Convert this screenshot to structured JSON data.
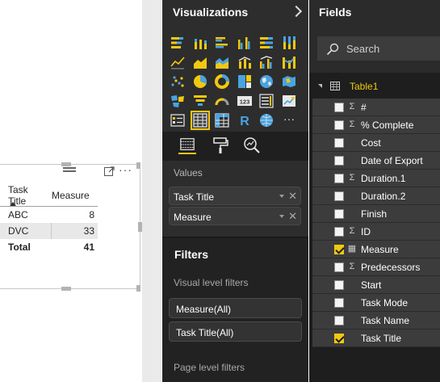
{
  "visual": {
    "table": {
      "columns": [
        "Task Title",
        "Measure"
      ],
      "rows": [
        {
          "task_title": "ABC",
          "measure": "8"
        },
        {
          "task_title": "DVC",
          "measure": "33"
        }
      ],
      "total": {
        "label": "Total",
        "value": "41"
      }
    },
    "more_label": "···"
  },
  "visualizations": {
    "title": "Visualizations",
    "icons": [
      "stacked-bar-chart",
      "stacked-column-chart",
      "clustered-bar-chart",
      "clustered-column-chart",
      "100-stacked-bar-chart",
      "100-stacked-column-chart",
      "line-chart",
      "area-chart",
      "stacked-area-chart",
      "line-and-stacked-column-chart",
      "line-and-clustered-column-chart",
      "ribbon-chart",
      "scatter-chart",
      "pie-chart",
      "donut-chart",
      "treemap",
      "map",
      "filled-map",
      "shape-map",
      "funnel",
      "gauge",
      "card",
      "multi-row-card",
      "kpi",
      "slicer",
      "table",
      "matrix",
      "r-script-visual",
      "globe-map",
      "more"
    ],
    "icon_text": {
      "card": "123",
      "r_visual": "R",
      "more": "···"
    },
    "selected_icon": "table",
    "tabs": [
      "fields",
      "format",
      "analytics"
    ],
    "values_label": "Values",
    "values": [
      {
        "label": "Task Title",
        "remove": "✕"
      },
      {
        "label": "Measure",
        "remove": "✕"
      }
    ],
    "filters": {
      "title": "Filters",
      "visual_level_label": "Visual level filters",
      "visual_level": [
        "Measure(All)",
        "Task Title(All)"
      ],
      "page_level_label": "Page level filters"
    },
    "accent": "#f2c811"
  },
  "fields": {
    "title": "Fields",
    "search_placeholder": "Search",
    "table_name": "Table1",
    "items": [
      {
        "label": "#",
        "icon": "sigma",
        "checked": false
      },
      {
        "label": "% Complete",
        "icon": "sigma",
        "checked": false
      },
      {
        "label": "Cost",
        "icon": "none",
        "checked": false
      },
      {
        "label": "Date of Export",
        "icon": "none",
        "checked": false
      },
      {
        "label": "Duration.1",
        "icon": "sigma",
        "checked": false
      },
      {
        "label": "Duration.2",
        "icon": "none",
        "checked": false
      },
      {
        "label": "Finish",
        "icon": "none",
        "checked": false
      },
      {
        "label": "ID",
        "icon": "sigma",
        "checked": false
      },
      {
        "label": "Measure",
        "icon": "calculator",
        "checked": true
      },
      {
        "label": "Predecessors",
        "icon": "sigma",
        "checked": false
      },
      {
        "label": "Start",
        "icon": "none",
        "checked": false
      },
      {
        "label": "Task Mode",
        "icon": "none",
        "checked": false
      },
      {
        "label": "Task Name",
        "icon": "none",
        "checked": false
      },
      {
        "label": "Task Title",
        "icon": "none",
        "checked": true
      }
    ],
    "sigma_glyph": "Σ",
    "calc_glyph": "▦"
  }
}
